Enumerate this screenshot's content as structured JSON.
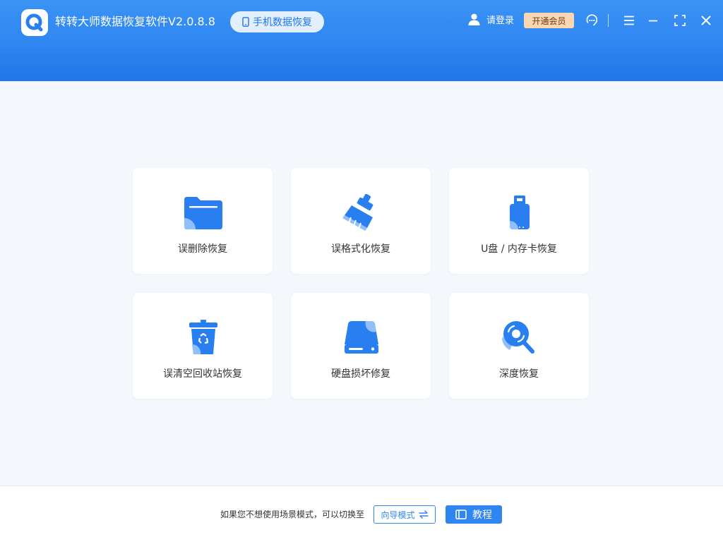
{
  "header": {
    "app_title": "转转大师数据恢复软件V2.0.8.8",
    "mobile_recovery_label": "手机数据恢复",
    "login_label": "请登录",
    "vip_label": "开通会员",
    "icons": [
      "app-logo-icon",
      "phone-icon",
      "user-icon",
      "support-icon",
      "menu-icon",
      "minimize-icon",
      "maximize-icon",
      "close-icon"
    ]
  },
  "recovery_modes": [
    {
      "label": "误删除恢复",
      "icon": "folder-icon"
    },
    {
      "label": "误格式化恢复",
      "icon": "broom-icon"
    },
    {
      "label": "U盘 / 内存卡恢复",
      "icon": "usb-drive-icon"
    },
    {
      "label": "误清空回收站恢复",
      "icon": "recycle-bin-icon"
    },
    {
      "label": "硬盘损坏修复",
      "icon": "hard-disk-icon"
    },
    {
      "label": "深度恢复",
      "icon": "deep-scan-icon"
    }
  ],
  "footer": {
    "hint_text": "如果您不想使用场景模式，可以切换至",
    "guide_mode_label": "向导模式",
    "tutorial_label": "教程"
  },
  "colors": {
    "brand_blue": "#2f86f0",
    "header_gradient_top": "#3a93f5",
    "header_gradient_bottom": "#1f76ea",
    "icon_blue": "#2a7ff0",
    "icon_light_blue": "#8fc0f9",
    "vip_bg": "#fbd6b2",
    "background": "#f4f7fc"
  }
}
